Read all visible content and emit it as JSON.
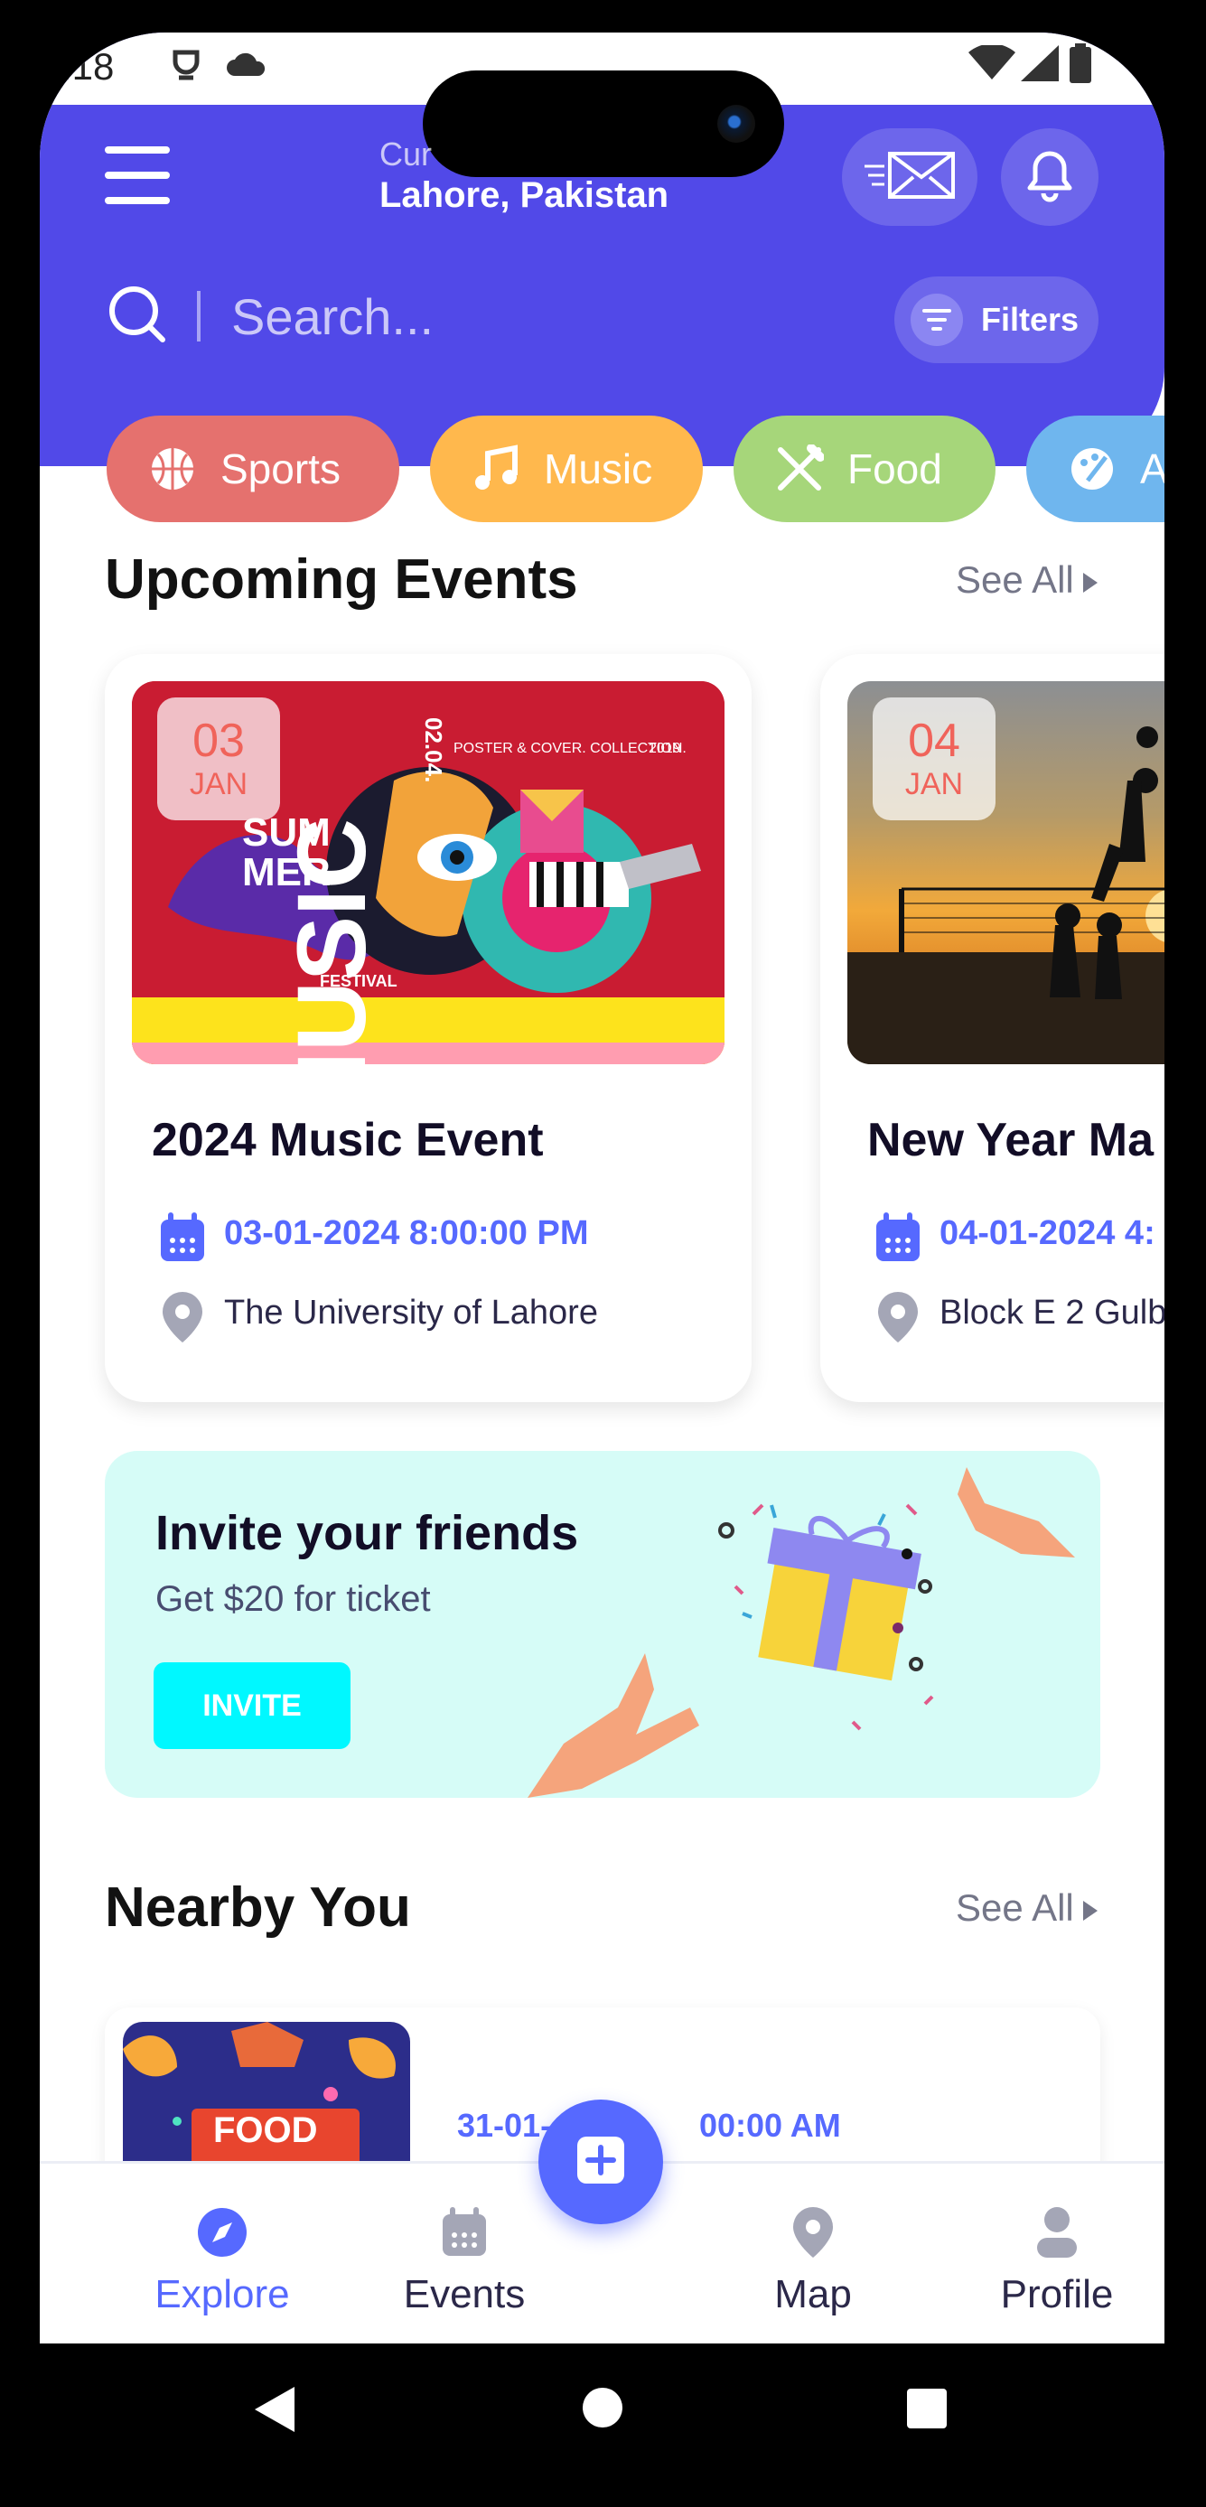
{
  "status_bar": {
    "time": ".18"
  },
  "header": {
    "location_caption": "Cur",
    "location": "Lahore, Pakistan",
    "search_placeholder": "Search...",
    "filters_label": "Filters"
  },
  "categories": [
    {
      "label": "Sports",
      "color": "#f0635a"
    },
    {
      "label": "Music",
      "color": "#f59762"
    },
    {
      "label": "Food",
      "color": "#29d697"
    },
    {
      "label": "A",
      "color": "#46cdfb"
    }
  ],
  "upcoming": {
    "title": "Upcoming Events",
    "see_all": "See All",
    "events": [
      {
        "day": "03",
        "month": "JAN",
        "title": "2024 Music Event",
        "datetime": "03-01-2024 8:00:00 PM",
        "location": "The University of Lahore",
        "poster": {
          "word1": "SUM",
          "word2": "MER",
          "big": "MUSIC",
          "sub": "FESTIVAL",
          "date": "02.04.",
          "caption": "POSTER & COVER. COLLECTION.",
          "year": "2019"
        }
      },
      {
        "day": "04",
        "month": "JAN",
        "title": "New Year Ma",
        "datetime": "04-01-2024 4:",
        "location": "Block E 2 Gulb"
      }
    ]
  },
  "invite": {
    "title": "Invite your friends",
    "subtitle": "Get $20 for ticket",
    "button": "INVITE"
  },
  "nearby": {
    "title": "Nearby You",
    "see_all": "See All",
    "item": {
      "image_text": "FOOD",
      "datetime_prefix": "31-01-",
      "datetime_suffix": "00:00 AM"
    }
  },
  "bottom_nav": [
    {
      "label": "Explore",
      "active": true
    },
    {
      "label": "Events",
      "active": false
    },
    {
      "label": "Map",
      "active": false
    },
    {
      "label": "Profile",
      "active": false
    }
  ],
  "colors": {
    "primary": "#5149e8",
    "accent": "#5669ff",
    "date_red": "#f0635a",
    "invite_bg": "#d6fcf7",
    "invite_button": "#00f8ff"
  }
}
